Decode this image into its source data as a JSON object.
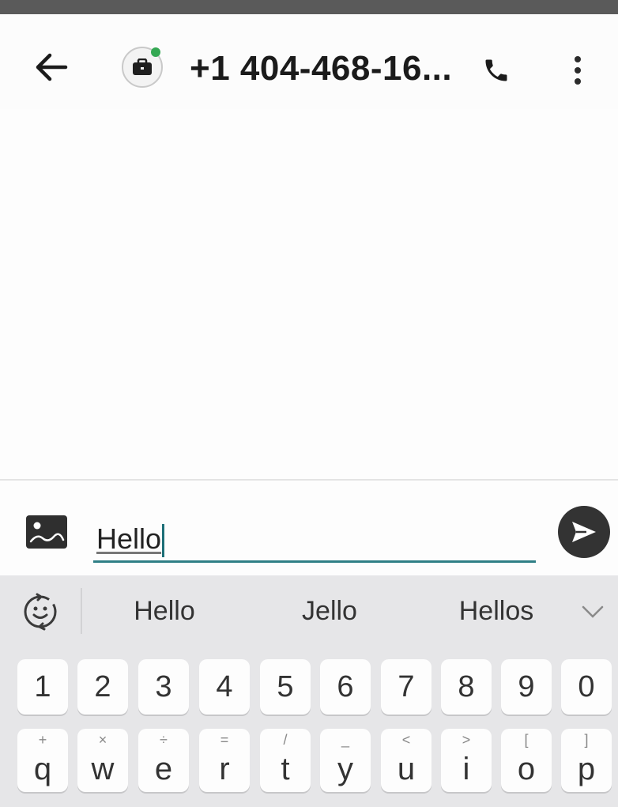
{
  "app_bar": {
    "contact": "+1 404-468-16..."
  },
  "compose": {
    "message_value": "Hello"
  },
  "keyboard": {
    "suggestions": [
      "Hello",
      "Jello",
      "Hellos"
    ],
    "number_row": [
      "1",
      "2",
      "3",
      "4",
      "5",
      "6",
      "7",
      "8",
      "9",
      "0"
    ],
    "letter_row": [
      {
        "key": "q",
        "hint": "+"
      },
      {
        "key": "w",
        "hint": "×"
      },
      {
        "key": "e",
        "hint": "÷"
      },
      {
        "key": "r",
        "hint": "="
      },
      {
        "key": "t",
        "hint": "/"
      },
      {
        "key": "y",
        "hint": "_"
      },
      {
        "key": "u",
        "hint": "<"
      },
      {
        "key": "i",
        "hint": ">"
      },
      {
        "key": "o",
        "hint": "["
      },
      {
        "key": "p",
        "hint": "]"
      }
    ]
  },
  "colors": {
    "accent_underline": "#2f7f86",
    "presence": "#34a853",
    "send_button": "#333333",
    "keyboard_bg": "#e6e6e8"
  },
  "icons": [
    "back-arrow-icon",
    "briefcase-icon",
    "phone-icon",
    "more-vert-icon",
    "image-icon",
    "send-icon",
    "emoji-icon",
    "chevron-down-icon"
  ]
}
